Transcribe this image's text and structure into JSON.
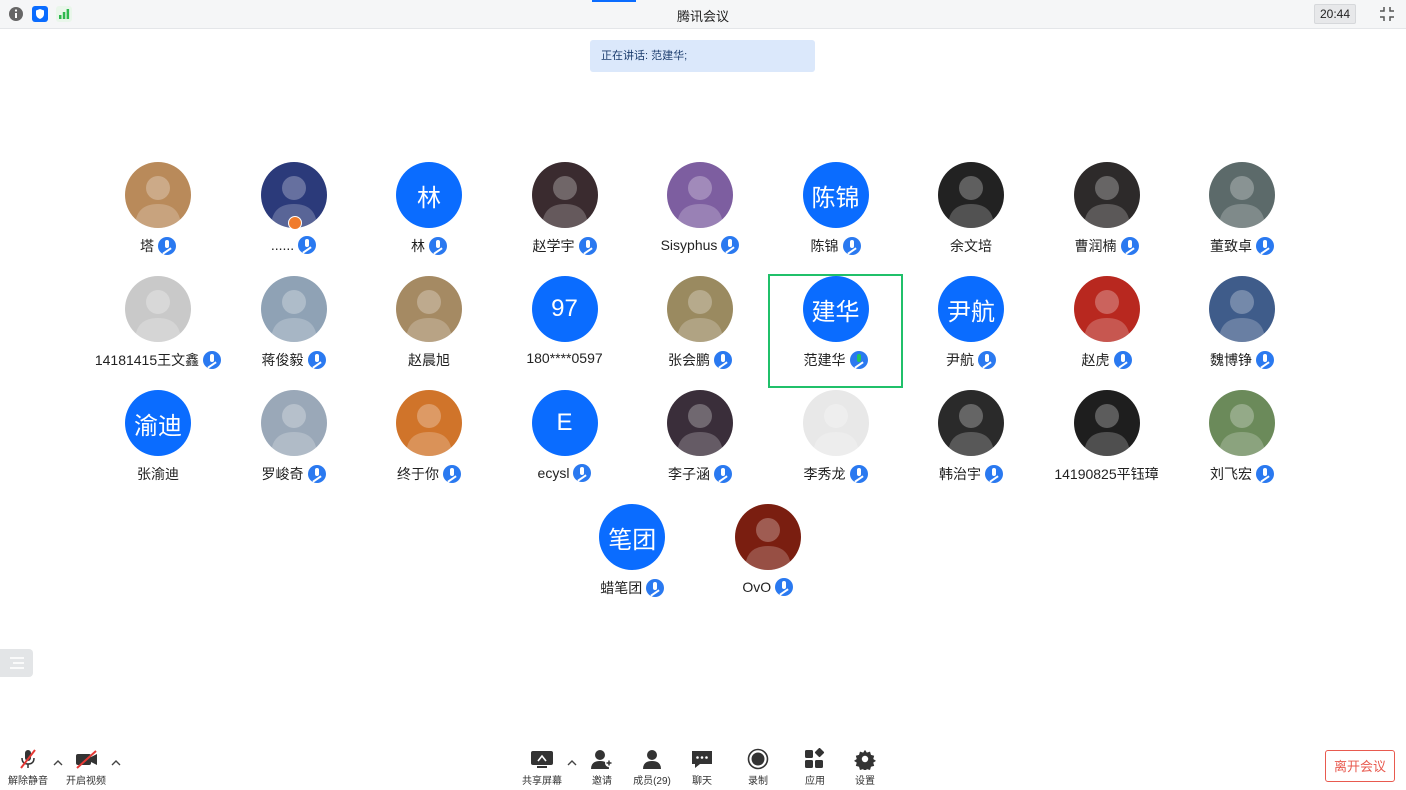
{
  "window": {
    "title": "腾讯会议",
    "clock": "20:44"
  },
  "speaking": {
    "text": "正在讲话: 范建华;"
  },
  "participants": [
    [
      {
        "name": "塔",
        "avatar": "photo",
        "color": "#b98a5a",
        "mic": true
      },
      {
        "name": "......",
        "avatar": "photo",
        "color": "#2b3a7a",
        "mic": true,
        "host": true
      },
      {
        "name": "林",
        "avatar": "text",
        "text": "林",
        "mic": true
      },
      {
        "name": "赵学宇",
        "avatar": "photo",
        "color": "#3a2b2f",
        "mic": true
      },
      {
        "name": "Sisyphus",
        "avatar": "photo",
        "color": "#7d5ea0",
        "mic": true
      },
      {
        "name": "陈锦",
        "avatar": "text",
        "text": "陈锦",
        "mic": true
      },
      {
        "name": "余文培",
        "avatar": "photo",
        "color": "#222222",
        "mic": false
      },
      {
        "name": "曹润楠",
        "avatar": "photo",
        "color": "#2d2a2a",
        "mic": true
      },
      {
        "name": "董致卓",
        "avatar": "photo",
        "color": "#5c6a6a",
        "mic": true
      }
    ],
    [
      {
        "name": "14181415王文鑫",
        "avatar": "photo",
        "color": "#c9c9c9",
        "mic": true
      },
      {
        "name": "蒋俊毅",
        "avatar": "photo",
        "color": "#8fa2b5",
        "mic": true
      },
      {
        "name": "赵晨旭",
        "avatar": "photo",
        "color": "#a58a63",
        "mic": false
      },
      {
        "name": "180****0597",
        "avatar": "text",
        "text": "97",
        "mic": false
      },
      {
        "name": "张会鹏",
        "avatar": "photo",
        "color": "#9a8a60",
        "mic": true
      },
      {
        "name": "范建华",
        "avatar": "text",
        "text": "建华",
        "mic": true,
        "speaking": true
      },
      {
        "name": "尹航",
        "avatar": "text",
        "text": "尹航",
        "mic": true
      },
      {
        "name": "赵虎",
        "avatar": "photo",
        "color": "#b8281f",
        "mic": true
      },
      {
        "name": "魏博铮",
        "avatar": "photo",
        "color": "#3f5c8a",
        "mic": true
      }
    ],
    [
      {
        "name": "张渝迪",
        "avatar": "text",
        "text": "渝迪",
        "mic": false
      },
      {
        "name": "罗峻奇",
        "avatar": "photo",
        "color": "#9aa8b8",
        "mic": true
      },
      {
        "name": "终于你",
        "avatar": "photo",
        "color": "#d0742a",
        "mic": true
      },
      {
        "name": "ecysl",
        "avatar": "text",
        "text": "E",
        "mic": true
      },
      {
        "name": "李子涵",
        "avatar": "photo",
        "color": "#3a2e3a",
        "mic": true
      },
      {
        "name": "李秀龙",
        "avatar": "photo",
        "color": "#e8e8e8",
        "mic": true
      },
      {
        "name": "韩治宇",
        "avatar": "photo",
        "color": "#2a2a2a",
        "mic": true
      },
      {
        "name": "14190825平钰璋",
        "avatar": "photo",
        "color": "#1e1e1e",
        "mic": false
      },
      {
        "name": "刘飞宏",
        "avatar": "photo",
        "color": "#6b8a5a",
        "mic": true
      }
    ],
    [
      {
        "name": "蜡笔团",
        "avatar": "text",
        "text": "笔团",
        "mic": true
      },
      {
        "name": "OvO",
        "avatar": "photo",
        "color": "#7a1e10",
        "mic": true
      }
    ]
  ],
  "toolbar": {
    "unmute": "解除静音",
    "video": "开启视频",
    "share": "共享屏幕",
    "invite": "邀请",
    "members": "成员(29)",
    "chat": "聊天",
    "record": "录制",
    "apps": "应用",
    "settings": "设置",
    "leave": "离开会议"
  },
  "colors": {
    "accent": "#0a6cff",
    "speaking_border": "#20c06a",
    "leave": "#e85a4f"
  }
}
